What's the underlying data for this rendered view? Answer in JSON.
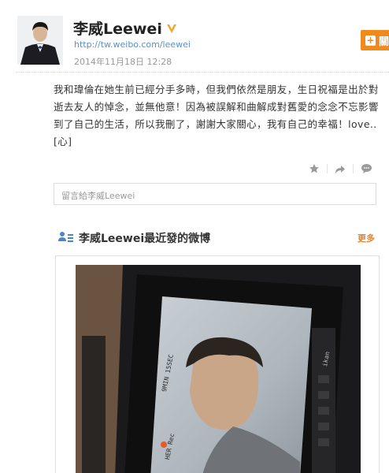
{
  "profile": {
    "name": "李威Leewei",
    "url": "http://tw.weibo.com/leewei",
    "date": "2014年11月18日 12:28",
    "verified_color": "#f5a623"
  },
  "follow_button": {
    "label": "關"
  },
  "post": {
    "text": "我和瑋倫在她生前已經分手多時，但我們依然是朋友，生日祝福是出於對逝去友人的悼念，並無他意！因為被誤解和曲解成對舊愛的念念不忘影響到了自己的生活，所以我刪了，謝謝大家關心，我有自己的幸福！love..[心]"
  },
  "actions": {
    "icons": [
      "star-icon",
      "forward-icon",
      "comment-icon"
    ]
  },
  "comment": {
    "placeholder": "留言給李威Leewei"
  },
  "recent": {
    "title": "李威Leewei最近發的微博",
    "more_label": "更多"
  },
  "photo": {
    "screen_texts": [
      "9MIN 15SEC",
      "HER Rec",
      "ikan"
    ]
  },
  "colors": {
    "accent_orange": "#f08a1c",
    "link_blue": "#5b8fc7",
    "more_orange": "#e5842e"
  }
}
